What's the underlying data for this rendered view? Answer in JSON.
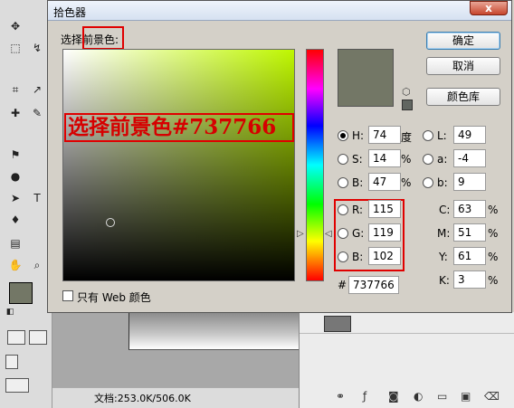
{
  "dialog": {
    "title": "拾色器",
    "close_glyph": "x",
    "select_label": "选择前景色:",
    "annotation": "选择前景色#737766",
    "only_web": "只有 Web 颜色",
    "buttons": {
      "ok": "确定",
      "cancel": "取消",
      "library": "颜色库"
    }
  },
  "fields": {
    "H": {
      "label": "H:",
      "value": "74",
      "unit": "度"
    },
    "S": {
      "label": "S:",
      "value": "14",
      "unit": "%"
    },
    "Bv": {
      "label": "B:",
      "value": "47",
      "unit": "%"
    },
    "R": {
      "label": "R:",
      "value": "115"
    },
    "G": {
      "label": "G:",
      "value": "119"
    },
    "Bc": {
      "label": "B:",
      "value": "102"
    },
    "L": {
      "label": "L:",
      "value": "49"
    },
    "a": {
      "label": "a:",
      "value": "-4"
    },
    "b": {
      "label": "b:",
      "value": "9"
    },
    "C": {
      "label": "C:",
      "value": "63",
      "unit": "%"
    },
    "M": {
      "label": "M:",
      "value": "51",
      "unit": "%"
    },
    "Y": {
      "label": "Y:",
      "value": "61",
      "unit": "%"
    },
    "K": {
      "label": "K:",
      "value": "3",
      "unit": "%"
    },
    "hex": {
      "label": "#",
      "value": "737766"
    }
  },
  "colors": {
    "current": "#737766",
    "previous": "#616661",
    "hue_top": "#bff700",
    "annotation_red": "#e00000"
  },
  "status": {
    "doc_size": "文档:253.0K/506.0K"
  },
  "toolbox": {
    "icons": [
      "move-icon",
      "marquee-icon",
      "lasso-icon",
      "magic-wand-icon",
      "crop-icon",
      "eyedropper-icon",
      "healing-icon",
      "brush-icon",
      "stamp-icon",
      "history-brush-icon",
      "eraser-icon",
      "gradient-icon",
      "blur-icon",
      "dodge-icon",
      "selection-icon",
      "type-icon",
      "pen-icon",
      "shape-icon",
      "notes-icon",
      "eyedropper2-icon",
      "hand-icon",
      "zoom-icon"
    ]
  }
}
